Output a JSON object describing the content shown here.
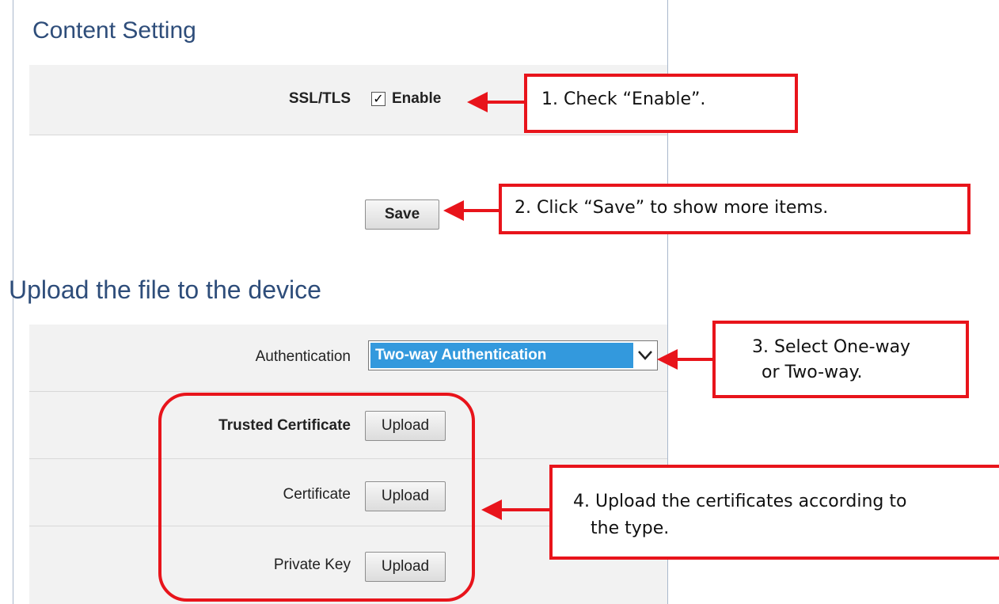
{
  "content_setting": {
    "title": "Content Setting",
    "ssl_label": "SSL/TLS",
    "enable_label": "Enable",
    "enable_checked": true,
    "save_label": "Save"
  },
  "upload_section": {
    "title": "Upload the file to the device",
    "auth_label": "Authentication",
    "auth_value": "Two-way Authentication",
    "rows": [
      {
        "label": "Trusted Certificate",
        "button": "Upload"
      },
      {
        "label": "Certificate",
        "button": "Upload"
      },
      {
        "label": "Private Key",
        "button": "Upload"
      }
    ]
  },
  "callouts": {
    "step1": "1.   Check “Enable”.",
    "step2": "2. Click “Save” to show more items.",
    "step3_line1": "3. Select One-way",
    "step3_line2": "or Two-way.",
    "step4_line1": "4. Upload the certificates according to",
    "step4_line2": "the type."
  },
  "colors": {
    "accent_red": "#e8141b",
    "title_blue": "#2e4d7a",
    "select_blue": "#3399dd"
  }
}
